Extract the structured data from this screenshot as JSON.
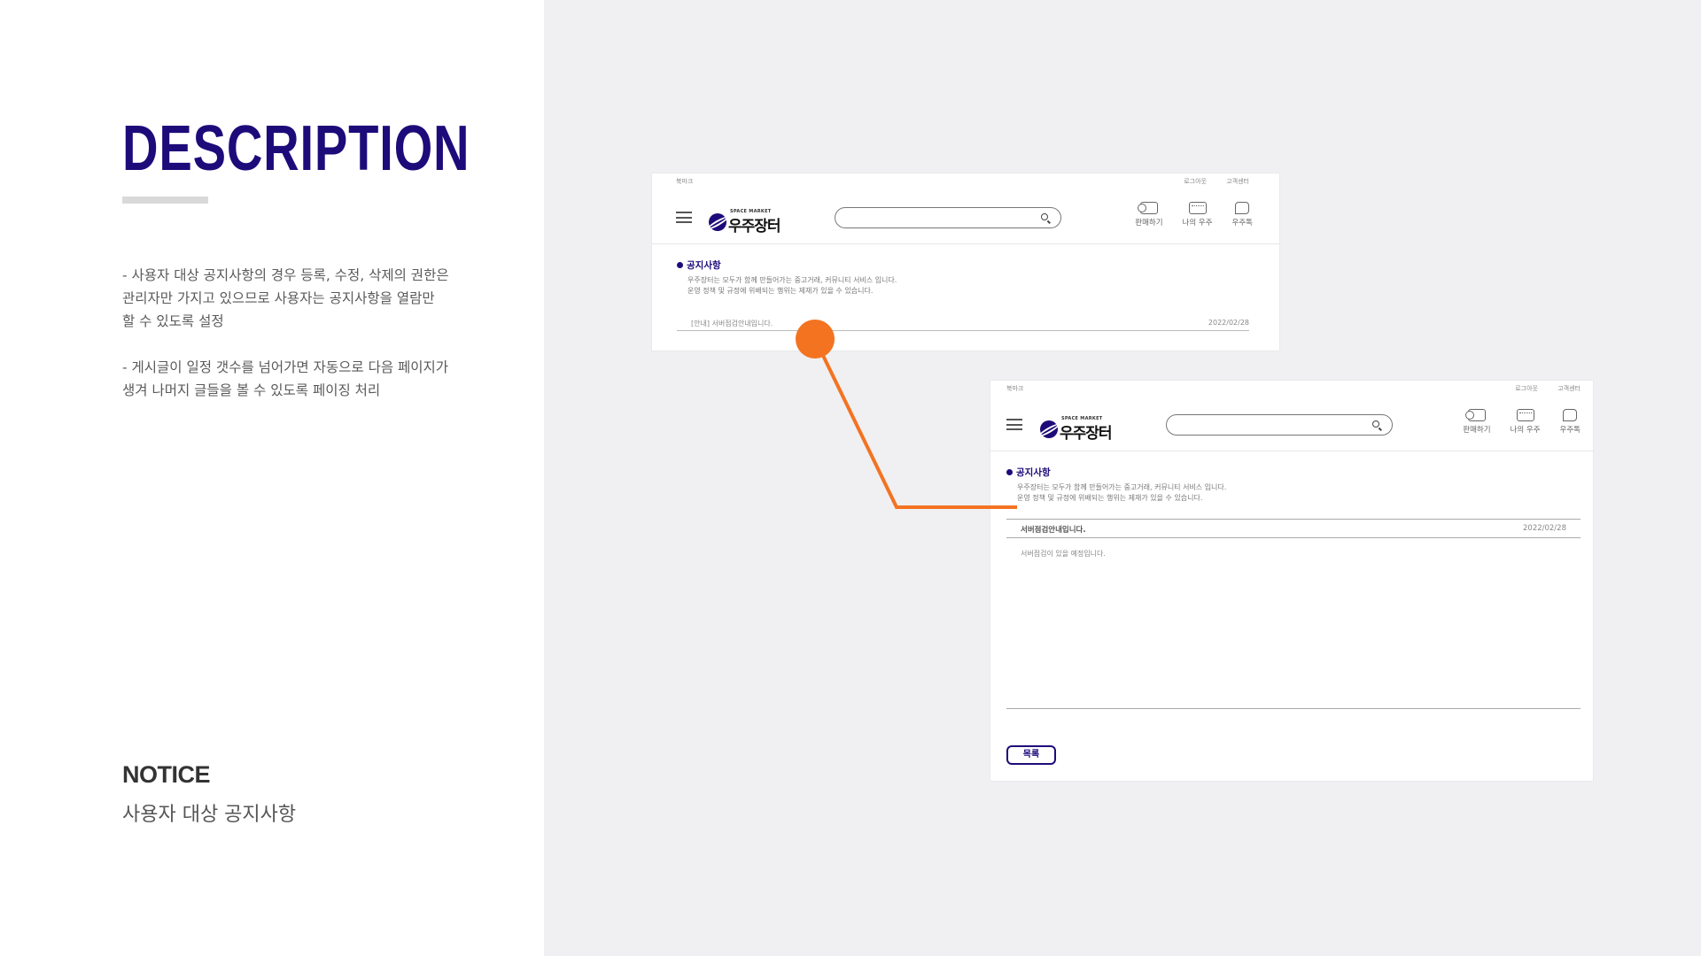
{
  "description": {
    "title": "DESCRIPTION",
    "para1": "- 사용자 대상 공지사항의 경우 등록, 수정, 삭제의 권한은 관리자만 가지고 있으므로 사용자는 공지사항을 열람만 할 수 있도록 설정",
    "para2": "- 게시글이 일정 갯수를 넘어가면 자동으로 다음 페이지가 생겨 나머지 글들을 볼 수 있도록 페이징 처리",
    "notice_label": "NOTICE",
    "notice_sub": "사용자 대상 공지사항"
  },
  "mock": {
    "bookmark": "북마크",
    "logout": "로그아웃",
    "customer_center": "고객센터",
    "logo_small": "SPACE MARKET",
    "logo_name": "우주장터",
    "search_placeholder": "",
    "nav": [
      {
        "label": "판매하기",
        "icon": "reel-icon"
      },
      {
        "label": "나의 우주",
        "icon": "shop-icon"
      },
      {
        "label": "우주톡",
        "icon": "chat-icon"
      }
    ],
    "section_title": "공지사항",
    "section_desc1": "우주장터는 모두가 함께 만들어가는 중고거래, 커뮤니티 서비스 입니다.",
    "section_desc2": "운영 정책 및 규정에 위배되는 행위는 제재가 있을 수 있습니다.",
    "list_item_title": "[안내] 서버점검안내입니다.",
    "list_item_date": "2022/02/28",
    "post_title": "서버점검안내입니다.",
    "post_date": "2022/02/28",
    "post_body": "서버점검이 있을 예정입니다.",
    "list_button": "목록"
  },
  "colors": {
    "brand": "#1e0b7a",
    "connector": "#f47321",
    "background_right": "#f0f0f2"
  }
}
